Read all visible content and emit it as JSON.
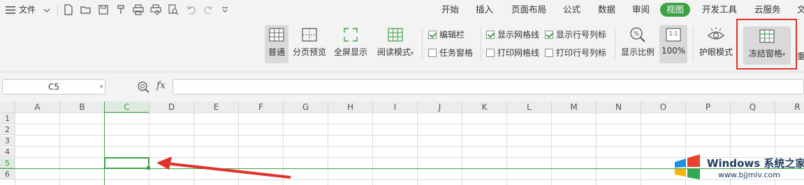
{
  "menubar": {
    "menu_icon": "hamburger-icon",
    "file_label": "文件",
    "tabs": [
      {
        "label": "开始"
      },
      {
        "label": "插入"
      },
      {
        "label": "页面布局"
      },
      {
        "label": "公式"
      },
      {
        "label": "数据"
      },
      {
        "label": "审阅"
      },
      {
        "label": "视图",
        "active": true
      },
      {
        "label": "开发工具"
      },
      {
        "label": "云服务"
      },
      {
        "label": "文"
      }
    ]
  },
  "ribbon": {
    "normal_label": "普通",
    "page_break_label": "分页预览",
    "fullscreen_label": "全屏显示",
    "reading_label": "阅读模式",
    "checkboxes": {
      "edit_bar": {
        "label": "编辑栏",
        "checked": true
      },
      "task_pane": {
        "label": "任务窗格",
        "checked": false
      },
      "show_gridlines": {
        "label": "显示网格线",
        "checked": true
      },
      "print_gridlines": {
        "label": "打印网格线",
        "checked": false
      },
      "show_headings": {
        "label": "显示行号列标",
        "checked": true
      },
      "print_headings": {
        "label": "打印行号列标",
        "checked": false
      }
    },
    "zoom_label": "显示比例",
    "zoom100_label": "100%",
    "zoom100_icon_text": "1:1",
    "eye_label": "护眼模式",
    "freeze_label": "冻结窗格",
    "next_label": "重"
  },
  "formula": {
    "namebox_value": "C5",
    "fx_label": "fx"
  },
  "grid": {
    "columns": [
      "A",
      "B",
      "C",
      "D",
      "E",
      "F",
      "G",
      "H",
      "I",
      "J",
      "K",
      "L",
      "M",
      "N",
      "O",
      "P",
      "Q",
      "R"
    ],
    "rows": [
      "1",
      "2",
      "3",
      "4",
      "5",
      "6"
    ],
    "selected_column": "C",
    "selected_row": "5"
  },
  "watermark": {
    "title": "Windows 系统之家",
    "url": "www.bjjmlv.com"
  },
  "colors": {
    "accent": "#3da244",
    "highlight_box": "#e0322b",
    "arrow": "#e0322b"
  }
}
